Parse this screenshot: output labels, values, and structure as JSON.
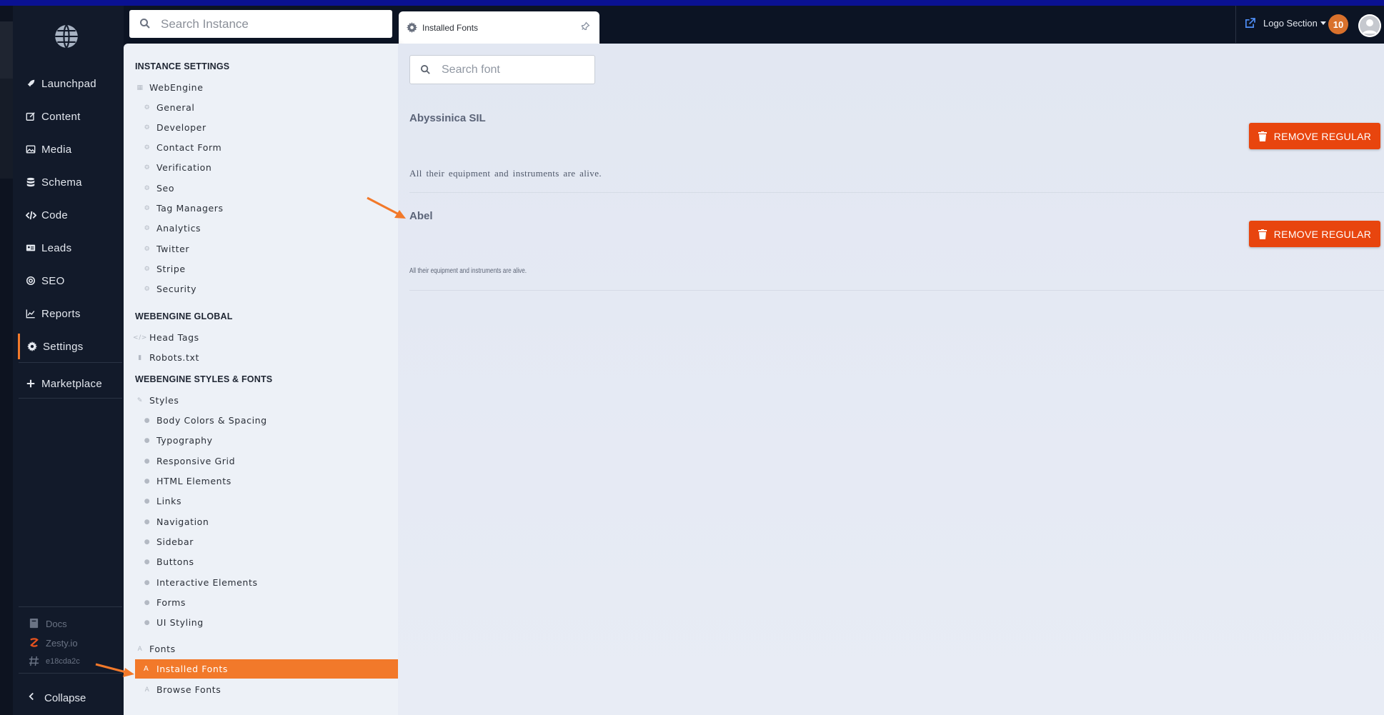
{
  "search_instance": {
    "placeholder": "Search Instance"
  },
  "tab": {
    "label": "Installed Fonts"
  },
  "topbar": {
    "logo_section_label": "Logo Section",
    "notification_count": "10"
  },
  "main_nav": {
    "items": [
      {
        "label": "Launchpad",
        "icon": "rocket-icon"
      },
      {
        "label": "Content",
        "icon": "edit-icon"
      },
      {
        "label": "Media",
        "icon": "image-icon"
      },
      {
        "label": "Schema",
        "icon": "database-icon"
      },
      {
        "label": "Code",
        "icon": "code-icon"
      },
      {
        "label": "Leads",
        "icon": "id-card-icon"
      },
      {
        "label": "SEO",
        "icon": "target-icon"
      },
      {
        "label": "Reports",
        "icon": "chart-icon"
      },
      {
        "label": "Settings",
        "icon": "gear-icon",
        "active": true
      },
      {
        "label": "Marketplace",
        "icon": "plus-icon"
      }
    ],
    "bottom": [
      {
        "label": "Docs",
        "icon": "book-icon"
      },
      {
        "label": "Zesty.io",
        "icon": "zesty-logo-icon"
      },
      {
        "label": "e18cda2c",
        "icon": "hash-icon"
      }
    ],
    "collapse_label": "Collapse"
  },
  "settings_panel": {
    "instance_settings": {
      "title": "INSTANCE SETTINGS",
      "root": "WebEngine",
      "items": [
        "General",
        "Developer",
        "Contact Form",
        "Verification",
        "Seo",
        "Tag Managers",
        "Analytics",
        "Twitter",
        "Stripe",
        "Security"
      ]
    },
    "webengine_global": {
      "title": "WEBENGINE GLOBAL",
      "items": [
        "Head Tags",
        "Robots.txt"
      ]
    },
    "styles_fonts": {
      "title": "WEBENGINE STYLES & FONTS",
      "styles_root": "Styles",
      "style_items": [
        "Body Colors & Spacing",
        "Typography",
        "Responsive Grid",
        "HTML Elements",
        "Links",
        "Navigation",
        "Sidebar",
        "Buttons",
        "Interactive Elements",
        "Forms",
        "UI Styling"
      ],
      "fonts_root": "Fonts",
      "font_items": [
        "Installed Fonts",
        "Browse Fonts"
      ],
      "active_item": "Installed Fonts"
    }
  },
  "content": {
    "search_font_placeholder": "Search font",
    "fonts": [
      {
        "name": "Abyssinica SIL",
        "button_label": "REMOVE REGULAR",
        "sample": "All their equipment and instruments are alive."
      },
      {
        "name": "Abel",
        "button_label": "REMOVE REGULAR",
        "sample": "All their equipment and instruments are alive."
      }
    ]
  },
  "colors": {
    "accent": "#f2792a",
    "danger": "#e8450e",
    "nav_bg": "#121a2a",
    "panel_bg": "#edf1f7"
  }
}
